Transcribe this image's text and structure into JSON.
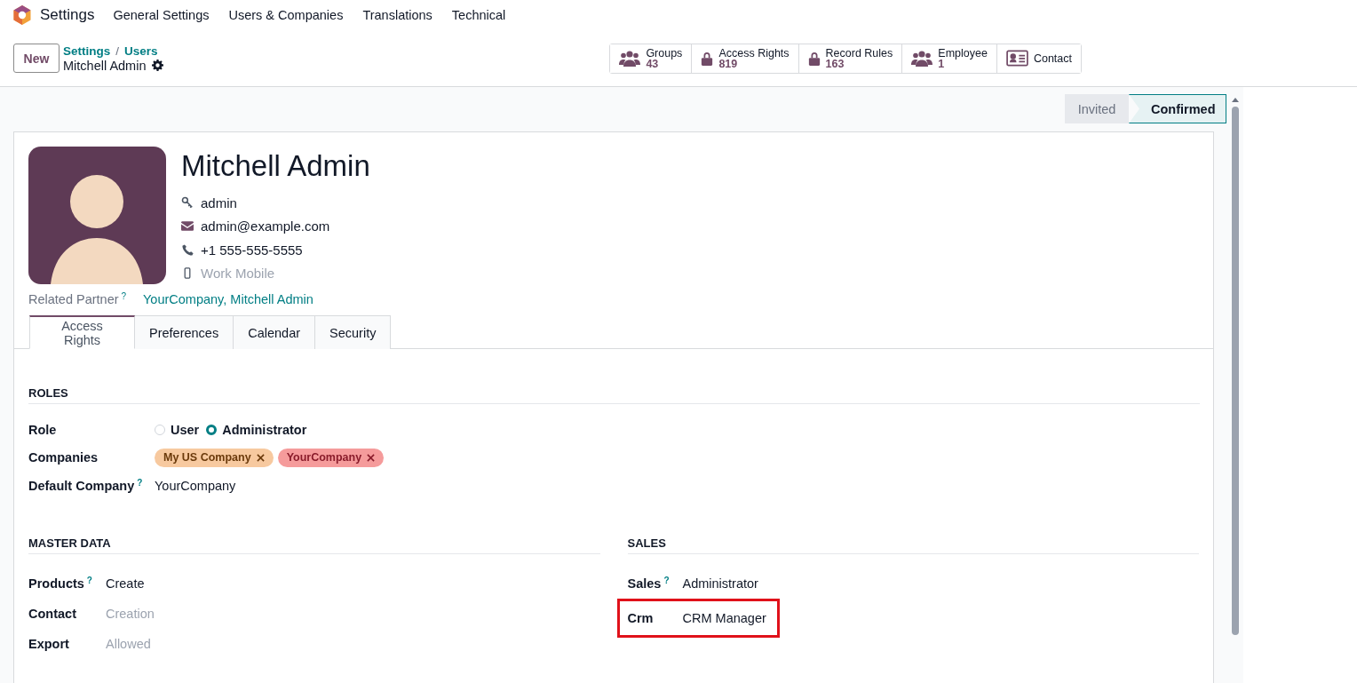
{
  "navbar": {
    "app": "Settings",
    "menus": [
      "General Settings",
      "Users & Companies",
      "Translations",
      "Technical"
    ]
  },
  "control_panel": {
    "new_button": "New",
    "breadcrumbs": [
      "Settings",
      "Users"
    ],
    "separator": "/",
    "record_title": "Mitchell Admin"
  },
  "smart_buttons": [
    {
      "kind": "users",
      "label": "Groups",
      "count": "43"
    },
    {
      "kind": "lock",
      "label": "Access Rights",
      "count": "819"
    },
    {
      "kind": "lock",
      "label": "Record Rules",
      "count": "163"
    },
    {
      "kind": "users",
      "label": "Employee",
      "count": "1"
    },
    {
      "kind": "card",
      "label": "Contact"
    }
  ],
  "status_bar": [
    {
      "label": "Invited",
      "selected": false
    },
    {
      "label": "Confirmed",
      "selected": true
    }
  ],
  "user": {
    "name": "Mitchell Admin",
    "fields": [
      {
        "kind": "key",
        "value": "admin"
      },
      {
        "kind": "mail",
        "value": "admin@example.com"
      },
      {
        "kind": "phone",
        "value": "+1 555-555-5555"
      },
      {
        "kind": "mobile",
        "placeholder": "Work Mobile"
      }
    ]
  },
  "related_partner": {
    "label": "Related Partner",
    "help": "?",
    "value": "YourCompany, Mitchell Admin"
  },
  "tabs": [
    {
      "label": "Access Rights",
      "selected": true
    },
    {
      "label": "Preferences",
      "selected": false
    },
    {
      "label": "Calendar",
      "selected": false
    },
    {
      "label": "Security",
      "selected": false
    }
  ],
  "roles": {
    "title": "ROLES",
    "role": {
      "label": "Role",
      "options": [
        {
          "label": "User",
          "selected": false
        },
        {
          "label": "Administrator",
          "selected": true
        }
      ]
    },
    "companies": {
      "label": "Companies",
      "tags": [
        {
          "label": "My US Company",
          "color": "#f7c99f"
        },
        {
          "label": "YourCompany",
          "color": "#f59b9b"
        }
      ]
    },
    "default_company": {
      "label": "Default Company",
      "help": "?",
      "value": "YourCompany"
    }
  },
  "sections": [
    {
      "title": "MASTER DATA",
      "rows": [
        {
          "label": "Products",
          "help": "?",
          "value": "Create",
          "muted": false,
          "highlighted": false
        },
        {
          "label": "Contact",
          "value": "Creation",
          "muted": true,
          "highlighted": false
        },
        {
          "label": "Export",
          "value": "Allowed",
          "muted": true,
          "highlighted": false
        }
      ]
    },
    {
      "title": "SALES",
      "rows": [
        {
          "label": "Sales",
          "help": "?",
          "value": "Administrator",
          "muted": false,
          "highlighted": false
        },
        {
          "label": "Crm",
          "value": "CRM Manager",
          "muted": false,
          "highlighted": true
        }
      ]
    }
  ]
}
